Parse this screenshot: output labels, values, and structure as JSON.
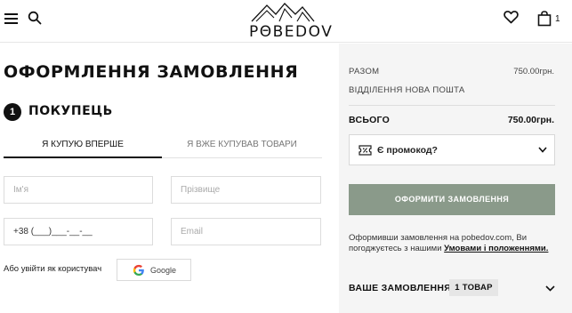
{
  "header": {
    "logo_text": "PΘBEDOV",
    "cart_count": "1",
    "icons": [
      "menu-icon",
      "search-icon",
      "logo-icon",
      "heart-icon",
      "bag-icon"
    ]
  },
  "checkout": {
    "title": "ОФОРМЛЕННЯ ЗАМОВЛЕННЯ",
    "step_number": "1",
    "step_title": "ПОКУПЕЦЬ",
    "tabs": [
      {
        "label": "Я КУПУЮ ВПЕРШЕ",
        "active": true
      },
      {
        "label": "Я ВЖЕ КУПУВАВ ТОВАРИ",
        "active": false
      }
    ],
    "fields": {
      "name_placeholder": "Ім'я",
      "surname_placeholder": "Прізвище",
      "phone_value": "+38 (___)___-__-__",
      "email_placeholder": "Email"
    },
    "login_label": "Або увійти як користувач",
    "google_label": "Google"
  },
  "summary": {
    "subtotal_label": "РАЗОМ",
    "subtotal_value": "750.00грн.",
    "delivery_label": "ВІДДІЛЕННЯ НОВА ПОШТА",
    "total_label": "ВСЬОГО",
    "total_value": "750.00грн.",
    "promo_label": "Є промокод?",
    "order_button": "ОФОРМИТИ ЗАМОВЛЕННЯ",
    "terms_text": "Оформивши замовлення на pobedov.com, Ви погоджуєтесь з нашими ",
    "terms_link": "Умовами і положеннями.",
    "your_order_label": "ВАШЕ ЗАМОВЛЕННЯ",
    "item_count": "1 ТОВАР",
    "colors": {
      "button": "#8a9a8a",
      "panel": "#f5f5f5"
    }
  }
}
